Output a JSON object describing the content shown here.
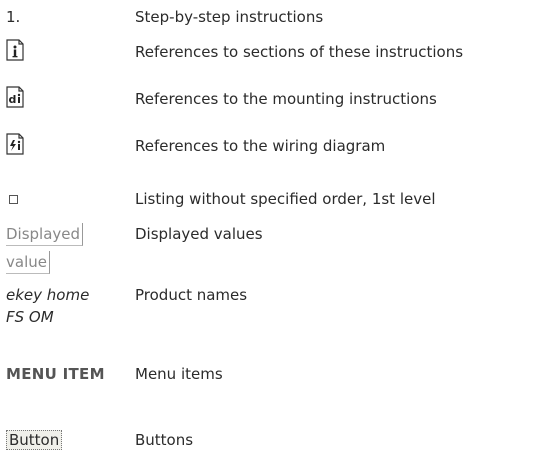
{
  "legend": [
    {
      "symbol_text": "1.",
      "description": "Step-by-step instructions"
    },
    {
      "symbol_icon": "info-document-icon",
      "icon_glyph": "i",
      "description": "References to sections of these instructions"
    },
    {
      "symbol_icon": "mounting-document-icon",
      "icon_glyph": "di",
      "description": "References to the mounting instructions"
    },
    {
      "symbol_icon": "wiring-document-icon",
      "icon_glyph": "⚡i",
      "description": "References to the wiring diagram"
    },
    {
      "symbol_icon": "square-bullet-icon",
      "description": "Listing without specified order, 1st level"
    },
    {
      "symbol_lines": [
        "Displayed",
        "value"
      ],
      "description": "Displayed values"
    },
    {
      "symbol_text": "ekey home FS OM",
      "description": "Product names"
    },
    {
      "symbol_text": "MENU ITEM",
      "description": "Menu items"
    },
    {
      "symbol_text": "Button",
      "description": "Buttons"
    }
  ]
}
